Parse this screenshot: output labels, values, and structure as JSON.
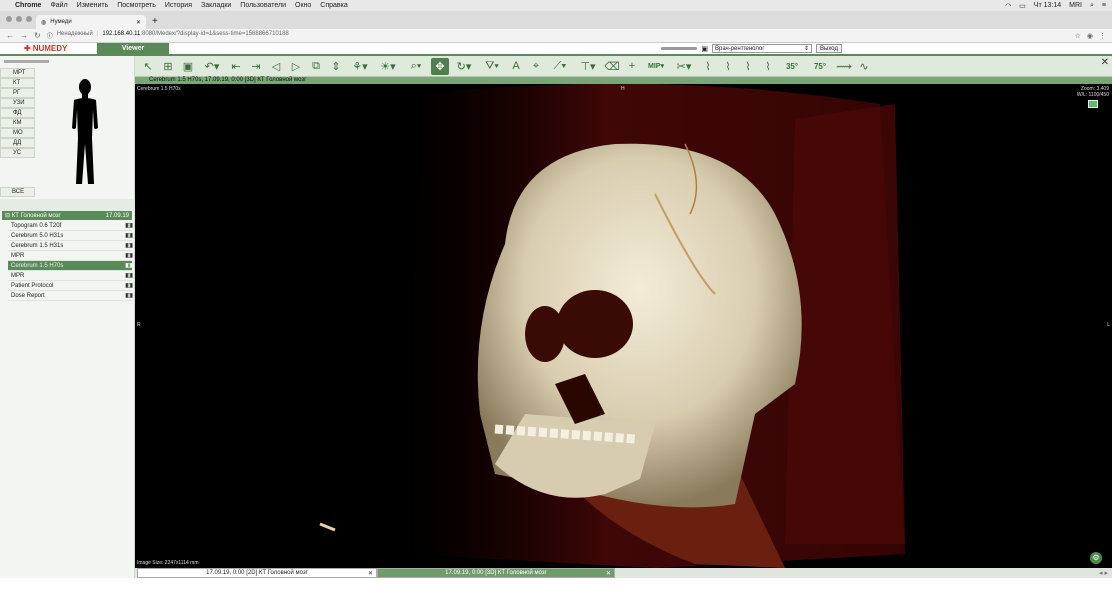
{
  "macos": {
    "apple": "",
    "app": "Chrome",
    "menu": [
      "Файл",
      "Изменить",
      "Посмотреть",
      "История",
      "Закладки",
      "Пользователи",
      "Окно",
      "Справка"
    ],
    "clock": "Чт 13:14",
    "user": "MRI"
  },
  "browser": {
    "tab_title": "Нумеди",
    "security": "Ненадежный",
    "url_host": "192.168.40.11",
    "url_rest": ":8080/Medex/?display-id=1&sess-time=1568866710188"
  },
  "app": {
    "logo": "NUMEDY",
    "viewer_tab": "Viewer",
    "role_select": "Врач-рентгенолог",
    "exit_label": "Выход"
  },
  "left": {
    "modalities": [
      "МРТ",
      "КТ",
      "РГ",
      "УЗИ",
      "ФД",
      "КМ",
      "МО",
      "ДД",
      "УС"
    ],
    "all_label": "ВСЕ",
    "study": {
      "name": "КТ Головной мозг",
      "date": "17.09.19"
    },
    "series": [
      {
        "name": "Topogram 0.6 T20f",
        "selected": false
      },
      {
        "name": "Cerebrum 5.0 H31s",
        "selected": false
      },
      {
        "name": "Cerebrum 1.5 H31s",
        "selected": false
      },
      {
        "name": "MPR",
        "selected": false
      },
      {
        "name": "Cerebrum 1.5 H70s",
        "selected": true
      },
      {
        "name": "MPR",
        "selected": false
      },
      {
        "name": "Patient Protocol",
        "selected": false
      },
      {
        "name": "Dose Report",
        "selected": false
      }
    ]
  },
  "toolbar": {
    "mip": "MIP",
    "angle35": "35°",
    "angle75": "75°"
  },
  "viewport": {
    "series_title": "Cerebrum 1.5 H70s, 17.09.19, 0:00 [3D] КТ Головной мозг",
    "series_small": "Cerebrum 1.5 H70s",
    "top_marker": "H",
    "left_marker": "R",
    "right_marker": "L",
    "zoom": "Zoom: 3,409",
    "wl": "W/L: 1100/450",
    "image_size": "Image Size: 2247x1114 mm"
  },
  "bottom_tabs": [
    {
      "label": "17.09.19, 0:00 [2D] КТ Головной мозг"
    },
    {
      "label": "17.09.19, 0:00 [3D] КТ Головной мозг"
    }
  ],
  "colors": {
    "accent": "#5a8a57",
    "toolbar_bg": "#dfe9dc"
  }
}
